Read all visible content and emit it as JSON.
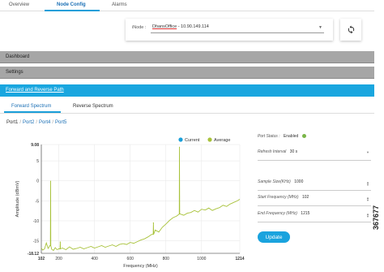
{
  "tabs": [
    "Overview",
    "Node Config",
    "Alarms"
  ],
  "node": {
    "label": "iNode :",
    "name": "DhansOffice",
    "ip": " - 10.90.149.114"
  },
  "sections": {
    "dashboard": "Dashboard",
    "settings": "Settings",
    "path": "Forward and Reverse Path"
  },
  "sub_tabs": [
    "Forward Spectrum",
    "Reverse Spectrum"
  ],
  "breadcrumb": {
    "current": "Port1",
    "links": [
      "Port2",
      "Port4",
      "Port5"
    ]
  },
  "form": {
    "port_status_label": "Port Status :",
    "port_status_value": "Enabled",
    "refresh_label": "Refresh Interval",
    "refresh_value": "30 s",
    "sample_label": "Sample Size(KHz)",
    "sample_value": "1000",
    "start_label": "Start Frequency (MHz)",
    "start_value": "102",
    "end_label": "End Frequency (MHz)",
    "end_value": "1215",
    "update_label": "Update"
  },
  "side_id": "367677",
  "colors": {
    "accent": "#19a6df",
    "series": "#a8c23a",
    "current": "#1a9fd9",
    "status": "#7ab648"
  },
  "chart_data": {
    "type": "line",
    "xlabel": "Frequency (MHz)",
    "ylabel": "Amplitude (dBmV)",
    "xlim": [
      102,
      1214
    ],
    "ylim": [
      -18.12,
      9.08
    ],
    "x_ticks": [
      102,
      200,
      400,
      600,
      800,
      1000,
      1214
    ],
    "y_ticks": [
      9.08,
      5,
      0,
      -5,
      -10,
      -15,
      -18.12
    ],
    "legend": [
      "Current",
      "Average"
    ],
    "series": [
      {
        "name": "Average",
        "x": [
          102,
          110,
          120,
          130,
          140,
          150,
          160,
          170,
          180,
          190,
          200,
          220,
          240,
          260,
          280,
          300,
          320,
          340,
          360,
          380,
          400,
          420,
          440,
          460,
          480,
          500,
          520,
          540,
          560,
          580,
          600,
          620,
          640,
          660,
          680,
          700,
          720,
          740,
          760,
          780,
          800,
          820,
          840,
          860,
          880,
          900,
          920,
          940,
          960,
          980,
          1000,
          1020,
          1040,
          1060,
          1080,
          1100,
          1120,
          1140,
          1160,
          1180,
          1200,
          1214
        ],
        "y": [
          -16.8,
          -17.3,
          -17.0,
          -15.5,
          -16.9,
          -16.2,
          -17.1,
          -17.4,
          -16.7,
          -17.2,
          -17.0,
          -16.8,
          -17.2,
          -16.5,
          -17.1,
          -16.9,
          -16.6,
          -17.0,
          -16.7,
          -16.4,
          -16.8,
          -16.5,
          -16.2,
          -16.6,
          -16.3,
          -16.0,
          -16.4,
          -15.9,
          -15.7,
          -15.9,
          -15.4,
          -15.6,
          -15.2,
          -14.8,
          -14.5,
          -14.0,
          -13.4,
          -12.3,
          -12.8,
          -11.6,
          -10.8,
          -9.9,
          -9.2,
          -8.8,
          -8.3,
          -8.6,
          -8.1,
          -7.9,
          -7.4,
          -7.8,
          -7.1,
          -7.3,
          -6.8,
          -7.4,
          -7.0,
          -6.7,
          -6.1,
          -6.4,
          -5.8,
          -5.4,
          -5.0,
          -4.6
        ]
      }
    ],
    "spikes": [
      {
        "x": 154,
        "y": 0.0
      },
      {
        "x": 208,
        "y": -15.2
      },
      {
        "x": 730,
        "y": -10.4
      },
      {
        "x": 876,
        "y": 8.5
      }
    ]
  }
}
